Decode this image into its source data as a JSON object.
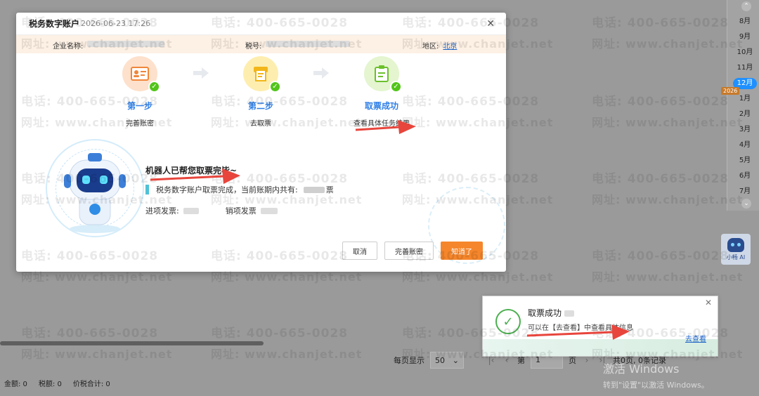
{
  "modal": {
    "title": "税务数字账户",
    "datetime": "2026-06-23 17:26",
    "info": {
      "company_label": "企业名称:",
      "tax_no_label": "税号:",
      "region_label": "地区:",
      "region_value": "北京"
    },
    "steps": [
      {
        "title": "第一步",
        "desc": "完善账密",
        "icon": "id-card-icon"
      },
      {
        "title": "第二步",
        "desc": "去取票",
        "icon": "invoice-machine-icon"
      },
      {
        "title": "取票成功",
        "desc": "查看具体任务结果",
        "icon": "clipboard-icon"
      }
    ],
    "result": {
      "title": "机器人已帮您取票完毕~",
      "summary": "税务数字账户取票完成，当前账期内共有:",
      "summary_unit": "票",
      "input_invoice_label": "进项发票:",
      "output_invoice_label": "销项发票"
    },
    "buttons": {
      "cancel": "取消",
      "complete_account": "完善账密",
      "ok": "知道了"
    }
  },
  "toast": {
    "title": "取票成功",
    "message": "可以在【去查看】中查看具体信息",
    "link": "去查看"
  },
  "months": {
    "items": [
      "8月",
      "9月",
      "10月",
      "11月",
      "12月",
      "1月",
      "2月",
      "3月",
      "4月",
      "5月",
      "6月",
      "7月"
    ],
    "active": "12月",
    "year_badge": "2026"
  },
  "ai_assistant": {
    "label": "小畅 AI"
  },
  "pagination": {
    "per_page_label": "每页显示",
    "per_page_value": "50",
    "page_prefix": "第",
    "page_value": "1",
    "page_suffix": "页",
    "total_text": "共0页, 0条记录"
  },
  "footer": {
    "amount": "金额:  0",
    "tax": "税额:  0",
    "total": "价税合计:  0"
  },
  "windows_activation": {
    "title": "激活 Windows",
    "subtitle": "转到\"设置\"以激活 Windows。"
  },
  "watermark": {
    "phone": "电话: 400-665-0028",
    "site": "网址: www.chanjet.net"
  },
  "colors": {
    "accent_blue": "#2f7fe6",
    "primary_orange": "#f5862b",
    "success_green": "#52c41a",
    "info_bar_bg": "#fdf0e4",
    "annotation_red": "#e8453c"
  }
}
